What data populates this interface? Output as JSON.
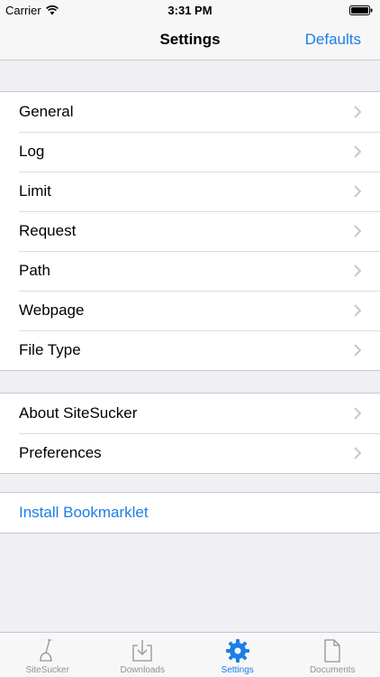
{
  "status_bar": {
    "carrier": "Carrier",
    "time": "3:31 PM"
  },
  "nav": {
    "title": "Settings",
    "defaults_label": "Defaults"
  },
  "groups": [
    {
      "items": [
        "General",
        "Log",
        "Limit",
        "Request",
        "Path",
        "Webpage",
        "File Type"
      ]
    },
    {
      "items": [
        "About SiteSucker",
        "Preferences"
      ]
    },
    {
      "items": [
        "Install Bookmarklet"
      ]
    }
  ],
  "tabs": [
    {
      "label": "SiteSucker",
      "icon": "vacuum-icon"
    },
    {
      "label": "Downloads",
      "icon": "download-tray-icon"
    },
    {
      "label": "Settings",
      "icon": "gear-icon",
      "active": true
    },
    {
      "label": "Documents",
      "icon": "document-icon"
    }
  ],
  "colors": {
    "accent": "#1a7ee6",
    "background": "#efeff4",
    "inactive_tab": "#929292"
  }
}
